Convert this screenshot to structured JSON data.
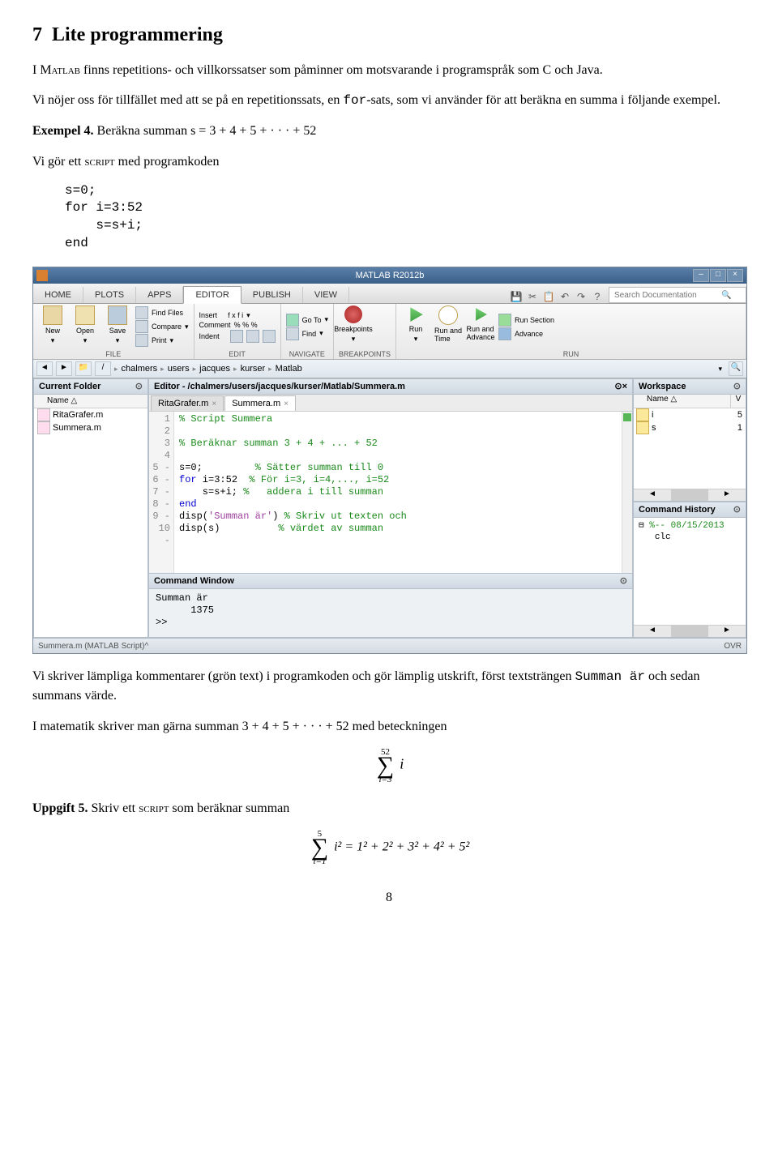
{
  "doc": {
    "h2_num": "7",
    "h2_title": "Lite programmering",
    "p1_a": "I ",
    "p1_b": "Matlab",
    "p1_c": " finns repetitions- och villkorssatser som påminner om motsvarande i programspråk som C och Java.",
    "p2_a": "Vi nöjer oss för tillfället med att se på en repetitionssats, en ",
    "p2_b": "for",
    "p2_c": "-sats, som vi använder för att beräkna en summa i följande exempel.",
    "ex_label": "Exempel 4.",
    "ex_text": " Beräkna summan s = 3 + 4 + 5 + · · · + 52",
    "p3_a": "Vi gör ett ",
    "p3_b": "script",
    "p3_c": " med programkoden",
    "code1": "s=0;\nfor i=3:52\n    s=s+i;\nend",
    "p4_a": "Vi skriver lämpliga kommentarer (grön text) i programkoden och gör lämplig utskrift, först textsträngen ",
    "p4_b": "Summan är",
    "p4_c": " och sedan summans värde.",
    "p5": "I matematik skriver man gärna summan 3 + 4 + 5 + · · · + 52 med beteckningen",
    "sum1_top": "52",
    "sum1_bot": "i=3",
    "sum1_rhs": "i",
    "upp_label": "Uppgift 5.",
    "upp_a": " Skriv ett ",
    "upp_b": "script",
    "upp_c": " som beräknar summan",
    "sum2_top": "5",
    "sum2_bot": "i=1",
    "sum2_eq": "i² = 1² + 2² + 3² + 4² + 5²",
    "pagenum": "8"
  },
  "ml": {
    "title": "MATLAB R2012b",
    "tabs": [
      "HOME",
      "PLOTS",
      "APPS",
      "EDITOR",
      "PUBLISH",
      "VIEW"
    ],
    "search_ph": "Search Documentation",
    "ribbon": {
      "file": {
        "new": "New",
        "open": "Open",
        "save": "Save",
        "find": "Find Files",
        "compare": "Compare",
        "print": "Print",
        "label": "FILE"
      },
      "edit": {
        "insert": "Insert",
        "comment": "Comment",
        "indent": "Indent",
        "ins_icons": "  f x  f i ",
        "com_icons": "%  %  %",
        "ind_icons": "",
        "goto": "Go To",
        "find": "Find",
        "label": "EDIT"
      },
      "nav": {
        "label": "NAVIGATE"
      },
      "bp": {
        "bp": "Breakpoints",
        "label": "BREAKPOINTS"
      },
      "run": {
        "run": "Run",
        "runtime": "Run and\nTime",
        "runadv": "Run and\nAdvance",
        "runsec": "Run Section",
        "advance": "Advance",
        "label": "RUN"
      }
    },
    "path": [
      "chalmers",
      "users",
      "jacques",
      "kurser",
      "Matlab"
    ],
    "panels": {
      "cf_title": "Current Folder",
      "cf_name": "Name △",
      "cf_items": [
        "RitaGrafer.m",
        "Summera.m"
      ],
      "ed_title": "Editor - /chalmers/users/jacques/kurser/Matlab/Summera.m",
      "ed_tabs": [
        "RitaGrafer.m",
        "Summera.m"
      ],
      "ed_lines": [
        {
          "n": "1",
          "dash": "",
          "t": [
            {
              "c": "cm",
              "s": "% Script Summera"
            }
          ]
        },
        {
          "n": "2",
          "dash": "",
          "t": []
        },
        {
          "n": "3",
          "dash": "",
          "t": [
            {
              "c": "cm",
              "s": "% Beräknar summan 3 + 4 + ... + 52"
            }
          ]
        },
        {
          "n": "4",
          "dash": "",
          "t": []
        },
        {
          "n": "5",
          "dash": "-",
          "t": [
            {
              "c": "",
              "s": "s=0;         "
            },
            {
              "c": "cm",
              "s": "% Sätter summan till 0"
            }
          ]
        },
        {
          "n": "6",
          "dash": "-",
          "t": [
            {
              "c": "kw",
              "s": "for"
            },
            {
              "c": "",
              "s": " i=3:52  "
            },
            {
              "c": "cm",
              "s": "% För i=3, i=4,..., i=52"
            }
          ]
        },
        {
          "n": "7",
          "dash": "-",
          "t": [
            {
              "c": "",
              "s": "    s=s+i; "
            },
            {
              "c": "cm",
              "s": "%   addera i till summan"
            }
          ]
        },
        {
          "n": "8",
          "dash": "-",
          "t": [
            {
              "c": "kw",
              "s": "end"
            }
          ]
        },
        {
          "n": "9",
          "dash": "-",
          "t": [
            {
              "c": "",
              "s": "disp("
            },
            {
              "c": "str",
              "s": "'Summan är'"
            },
            {
              "c": "",
              "s": ") "
            },
            {
              "c": "cm",
              "s": "% Skriv ut texten och"
            }
          ]
        },
        {
          "n": "10",
          "dash": "-",
          "t": [
            {
              "c": "",
              "s": "disp(s)          "
            },
            {
              "c": "cm",
              "s": "% värdet av summan"
            }
          ]
        }
      ],
      "cw_title": "Command Window",
      "cw_out": "Summan är\n      1375\n>> ",
      "ws_title": "Workspace",
      "ws_name": "Name △",
      "ws_val": "V",
      "ws_rows": [
        {
          "n": "i",
          "v": "5"
        },
        {
          "n": "s",
          "v": "1"
        }
      ],
      "ch_title": "Command History",
      "ch_date": "%-- 08/15/2013",
      "ch_cmd": "clc"
    },
    "status_left": "Summera.m (MATLAB Script)",
    "status_right": "OVR"
  }
}
